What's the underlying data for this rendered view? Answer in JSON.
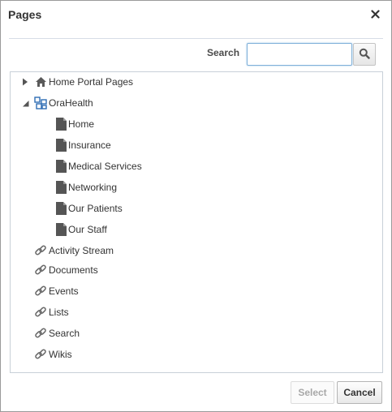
{
  "dialog": {
    "title": "Pages",
    "close_icon": "close-icon"
  },
  "search": {
    "label": "Search",
    "value": "",
    "placeholder": "",
    "button_icon": "search-icon"
  },
  "tree": {
    "nodes": [
      {
        "label": "Home Portal Pages",
        "icon": "home-icon",
        "disclosure": "collapsed",
        "level": 0
      },
      {
        "label": "OraHealth",
        "icon": "portal-icon",
        "disclosure": "expanded",
        "level": 0
      },
      {
        "label": "Home",
        "icon": "page-icon",
        "level": 1
      },
      {
        "label": "Insurance",
        "icon": "page-icon",
        "level": 1
      },
      {
        "label": "Medical Services",
        "icon": "page-icon",
        "level": 1
      },
      {
        "label": "Networking",
        "icon": "page-icon",
        "level": 1
      },
      {
        "label": "Our Patients",
        "icon": "page-icon",
        "level": 1
      },
      {
        "label": "Our Staff",
        "icon": "page-icon",
        "level": 1
      },
      {
        "label": "Activity Stream",
        "icon": "link-icon",
        "level": 0
      },
      {
        "label": "Documents",
        "icon": "link-icon",
        "level": 0
      },
      {
        "label": "Events",
        "icon": "link-icon",
        "level": 0
      },
      {
        "label": "Lists",
        "icon": "link-icon",
        "level": 0
      },
      {
        "label": "Search",
        "icon": "link-icon",
        "level": 0
      },
      {
        "label": "Wikis",
        "icon": "link-icon",
        "level": 0
      }
    ]
  },
  "footer": {
    "select_label": "Select",
    "select_enabled": false,
    "cancel_label": "Cancel"
  },
  "colors": {
    "portal_icon": "#2e6db4",
    "icon_gray": "#555555",
    "focus_border": "#7fb0d9"
  }
}
